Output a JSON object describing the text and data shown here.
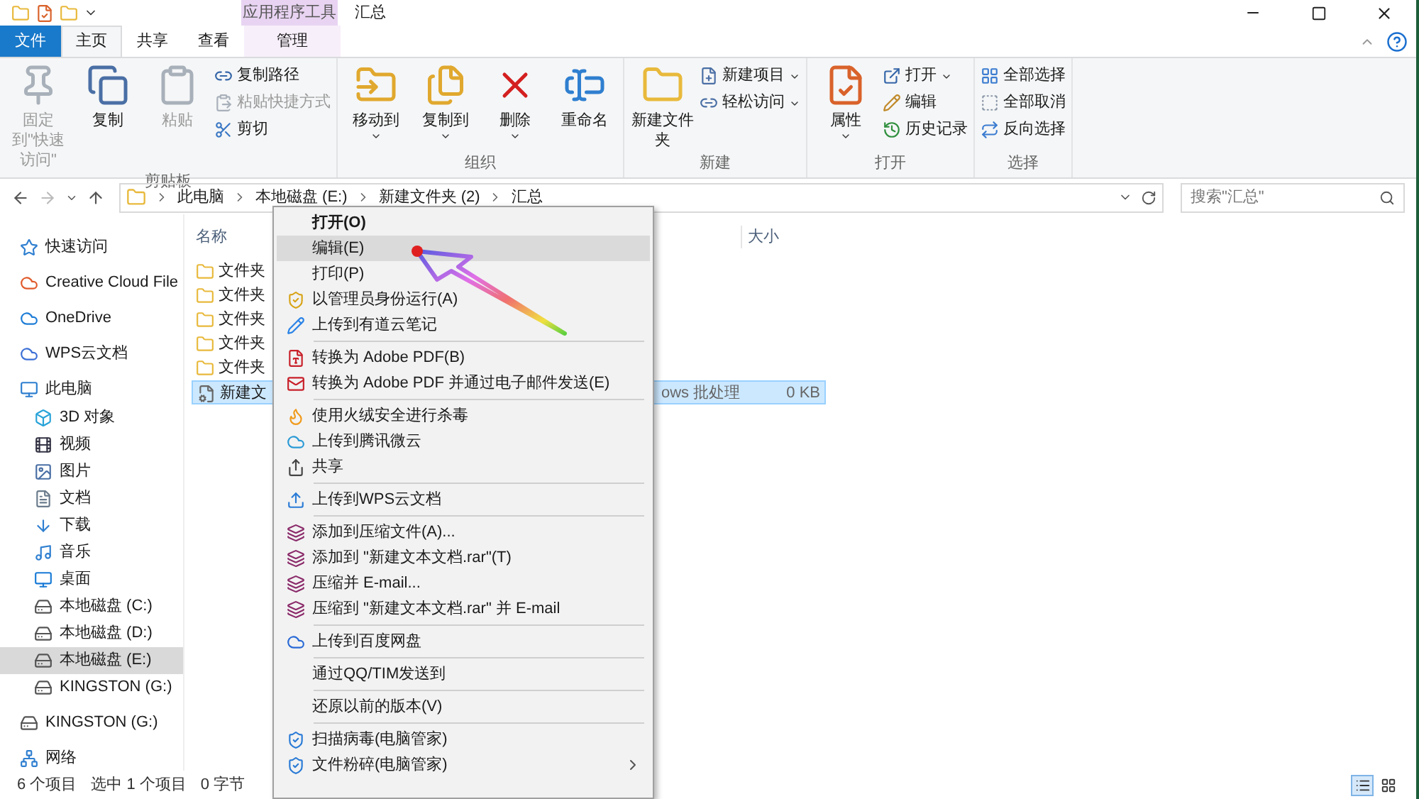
{
  "window": {
    "title": "汇总",
    "context_group": "应用程序工具"
  },
  "tabs": [
    {
      "label": "文件",
      "kind": "file",
      "selected": false
    },
    {
      "label": "主页",
      "kind": "tab",
      "selected": true
    },
    {
      "label": "共享",
      "kind": "tab",
      "selected": false
    },
    {
      "label": "查看",
      "kind": "tab",
      "selected": false
    },
    {
      "label": "管理",
      "kind": "context",
      "selected": false
    }
  ],
  "ribbon": {
    "groups": [
      {
        "label": "剪贴板",
        "large": [
          {
            "label": "固定到\"快速访问\"",
            "disabled": true,
            "dropdown": false
          },
          {
            "label": "复制",
            "disabled": false,
            "dropdown": false
          },
          {
            "label": "粘贴",
            "disabled": true,
            "dropdown": false
          }
        ],
        "small": [
          {
            "label": "复制路径",
            "disabled": false,
            "dropdown": false
          },
          {
            "label": "粘贴快捷方式",
            "disabled": true,
            "dropdown": false
          },
          {
            "label": "剪切",
            "disabled": false,
            "dropdown": false
          }
        ]
      },
      {
        "label": "组织",
        "large": [
          {
            "label": "移动到",
            "disabled": false,
            "dropdown": true
          },
          {
            "label": "复制到",
            "disabled": false,
            "dropdown": true
          },
          {
            "label": "删除",
            "disabled": false,
            "dropdown": true
          },
          {
            "label": "重命名",
            "disabled": false,
            "dropdown": false
          }
        ]
      },
      {
        "label": "新建",
        "large": [
          {
            "label": "新建文件夹",
            "disabled": false,
            "dropdown": false
          }
        ],
        "small": [
          {
            "label": "新建项目",
            "disabled": false,
            "dropdown": true
          },
          {
            "label": "轻松访问",
            "disabled": false,
            "dropdown": true
          }
        ]
      },
      {
        "label": "打开",
        "large": [
          {
            "label": "属性",
            "disabled": false,
            "dropdown": true
          }
        ],
        "small": [
          {
            "label": "打开",
            "disabled": false,
            "dropdown": true
          },
          {
            "label": "编辑",
            "disabled": false,
            "dropdown": false
          },
          {
            "label": "历史记录",
            "disabled": false,
            "dropdown": false
          }
        ]
      },
      {
        "label": "选择",
        "small": [
          {
            "label": "全部选择",
            "disabled": false,
            "dropdown": false
          },
          {
            "label": "全部取消",
            "disabled": false,
            "dropdown": false
          },
          {
            "label": "反向选择",
            "disabled": false,
            "dropdown": false
          }
        ]
      }
    ]
  },
  "address": {
    "breadcrumbs": [
      "此电脑",
      "本地磁盘 (E:)",
      "新建文件夹 (2)",
      "汇总"
    ],
    "search_placeholder": "搜索\"汇总\""
  },
  "sidebar": {
    "items": [
      {
        "label": "快速访问",
        "selected": false
      },
      {
        "label": "Creative Cloud File",
        "selected": false
      },
      {
        "label": "OneDrive",
        "selected": false
      },
      {
        "label": "WPS云文档",
        "selected": false
      },
      {
        "label": "此电脑",
        "selected": false,
        "children": [
          {
            "label": "3D 对象",
            "selected": false
          },
          {
            "label": "视频",
            "selected": false
          },
          {
            "label": "图片",
            "selected": false
          },
          {
            "label": "文档",
            "selected": false
          },
          {
            "label": "下载",
            "selected": false
          },
          {
            "label": "音乐",
            "selected": false
          },
          {
            "label": "桌面",
            "selected": false
          },
          {
            "label": "本地磁盘 (C:)",
            "selected": false
          },
          {
            "label": "本地磁盘 (D:)",
            "selected": false
          },
          {
            "label": "本地磁盘 (E:)",
            "selected": true
          },
          {
            "label": "KINGSTON (G:)",
            "selected": false
          }
        ]
      },
      {
        "label": "KINGSTON (G:)",
        "selected": false
      },
      {
        "label": "网络",
        "selected": false
      }
    ]
  },
  "file_list": {
    "columns": {
      "name": "名称",
      "size": "大小"
    },
    "rows": [
      {
        "name": "文件夹",
        "kind": "folder",
        "selected": false
      },
      {
        "name": "文件夹",
        "kind": "folder",
        "selected": false
      },
      {
        "name": "文件夹",
        "kind": "folder",
        "selected": false
      },
      {
        "name": "文件夹",
        "kind": "folder",
        "selected": false
      },
      {
        "name": "文件夹",
        "kind": "folder",
        "selected": false
      },
      {
        "name": "新建文",
        "kind": "batch",
        "selected": true,
        "type": "ows 批处理",
        "size": "0 KB"
      }
    ]
  },
  "context_menu": {
    "groups": [
      [
        {
          "label": "打开(O)",
          "default": true,
          "selected": false,
          "submenu": false
        },
        {
          "label": "编辑(E)",
          "default": false,
          "selected": true,
          "submenu": false
        },
        {
          "label": "打印(P)",
          "default": false,
          "selected": false,
          "submenu": false
        },
        {
          "label": "以管理员身份运行(A)",
          "default": false,
          "selected": false,
          "submenu": false
        },
        {
          "label": "上传到有道云笔记",
          "default": false,
          "selected": false,
          "submenu": false
        }
      ],
      [
        {
          "label": "转换为 Adobe PDF(B)",
          "default": false,
          "selected": false,
          "submenu": false
        },
        {
          "label": "转换为 Adobe PDF 并通过电子邮件发送(E)",
          "default": false,
          "selected": false,
          "submenu": false
        }
      ],
      [
        {
          "label": "使用火绒安全进行杀毒",
          "default": false,
          "selected": false,
          "submenu": false
        },
        {
          "label": "上传到腾讯微云",
          "default": false,
          "selected": false,
          "submenu": false
        },
        {
          "label": "共享",
          "default": false,
          "selected": false,
          "submenu": false
        }
      ],
      [
        {
          "label": "上传到WPS云文档",
          "default": false,
          "selected": false,
          "submenu": false
        }
      ],
      [
        {
          "label": "添加到压缩文件(A)...",
          "default": false,
          "selected": false,
          "submenu": false
        },
        {
          "label": "添加到 \"新建文本文档.rar\"(T)",
          "default": false,
          "selected": false,
          "submenu": false
        },
        {
          "label": "压缩并 E-mail...",
          "default": false,
          "selected": false,
          "submenu": false
        },
        {
          "label": "压缩到 \"新建文本文档.rar\" 并 E-mail",
          "default": false,
          "selected": false,
          "submenu": false
        }
      ],
      [
        {
          "label": "上传到百度网盘",
          "default": false,
          "selected": false,
          "submenu": false
        }
      ],
      [
        {
          "label": "通过QQ/TIM发送到",
          "default": false,
          "selected": false,
          "submenu": false
        }
      ],
      [
        {
          "label": "还原以前的版本(V)",
          "default": false,
          "selected": false,
          "submenu": false
        }
      ],
      [
        {
          "label": "扫描病毒(电脑管家)",
          "default": false,
          "selected": false,
          "submenu": false
        },
        {
          "label": "文件粉碎(电脑管家)",
          "default": false,
          "selected": false,
          "submenu": true
        }
      ]
    ]
  },
  "status_bar": {
    "item_count": "6 个项目",
    "selection": "选中 1 个项目",
    "selection_size": "0 字节"
  }
}
